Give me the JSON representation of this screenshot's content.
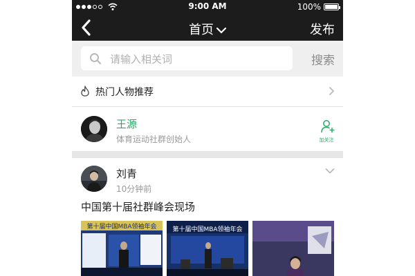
{
  "status_bar": {
    "time": "9:00 AM",
    "battery_text": "100%",
    "battery_level": 1.0
  },
  "nav": {
    "title": "首页",
    "publish_label": "发布"
  },
  "search": {
    "placeholder": "请输入相关词",
    "button_label": "搜索"
  },
  "hot_people": {
    "label": "热门人物推荐"
  },
  "person": {
    "name": "王源",
    "description": "体育运动社群创始人",
    "follow_label": "加关注"
  },
  "post": {
    "author": "刘青",
    "time": "10分钟前",
    "text": "中国第十届社群峰会现场",
    "photos": [
      {
        "banner": "第十届中国MBA领袖年会"
      },
      {
        "banner": "第十届中国MBA领袖年会"
      },
      {
        "banner": ""
      }
    ]
  },
  "colors": {
    "bar_bg": "#1c1c1c",
    "accent_green": "#2aa867",
    "muted_text": "#9a9a9a",
    "search_bg": "#efefef"
  }
}
